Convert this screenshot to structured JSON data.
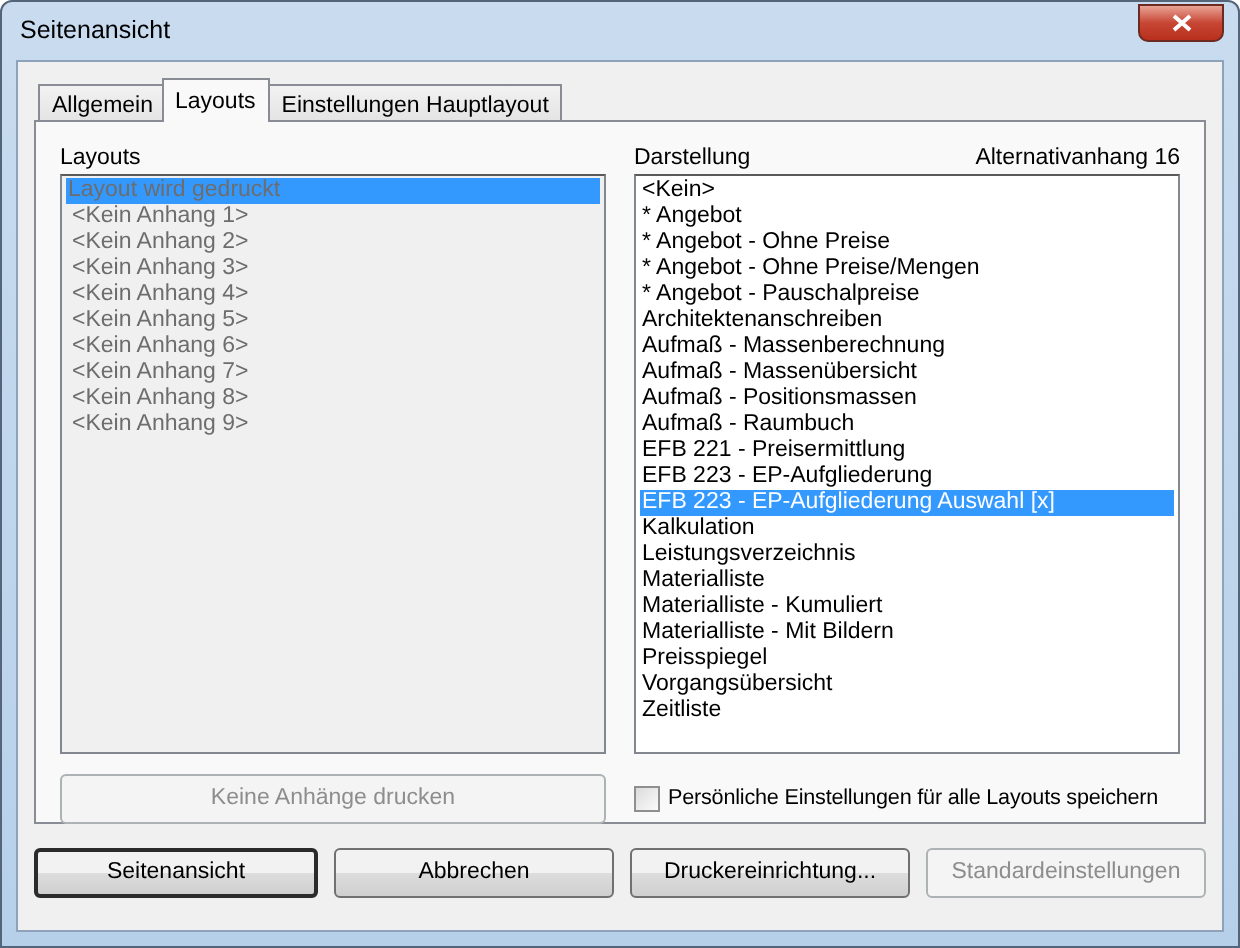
{
  "window": {
    "title": "Seitenansicht"
  },
  "tabs": [
    {
      "label": "Allgemein",
      "selected": false
    },
    {
      "label": "Layouts",
      "selected": true
    },
    {
      "label": "Einstellungen Hauptlayout",
      "selected": false
    }
  ],
  "layouts": {
    "label": "Layouts",
    "disabled": true,
    "items": [
      {
        "label": "Layout wird gedruckt",
        "selected": true
      },
      {
        "label": "<Kein Anhang 1>",
        "selected": false
      },
      {
        "label": "<Kein Anhang 2>",
        "selected": false
      },
      {
        "label": "<Kein Anhang 3>",
        "selected": false
      },
      {
        "label": "<Kein Anhang 4>",
        "selected": false
      },
      {
        "label": "<Kein Anhang 5>",
        "selected": false
      },
      {
        "label": "<Kein Anhang 6>",
        "selected": false
      },
      {
        "label": "<Kein Anhang 7>",
        "selected": false
      },
      {
        "label": "<Kein Anhang 8>",
        "selected": false
      },
      {
        "label": "<Kein Anhang 9>",
        "selected": false
      }
    ]
  },
  "darstellung": {
    "label": "Darstellung",
    "info": "Alternativanhang 16",
    "items": [
      {
        "label": "<Kein>",
        "selected": false
      },
      {
        "label": "* Angebot",
        "selected": false
      },
      {
        "label": "* Angebot - Ohne Preise",
        "selected": false
      },
      {
        "label": "* Angebot - Ohne Preise/Mengen",
        "selected": false
      },
      {
        "label": "* Angebot - Pauschalpreise",
        "selected": false
      },
      {
        "label": "Architektenanschreiben",
        "selected": false
      },
      {
        "label": "Aufmaß - Massenberechnung",
        "selected": false
      },
      {
        "label": "Aufmaß - Massenübersicht",
        "selected": false
      },
      {
        "label": "Aufmaß - Positionsmassen",
        "selected": false
      },
      {
        "label": "Aufmaß - Raumbuch",
        "selected": false
      },
      {
        "label": "EFB 221 - Preisermittlung",
        "selected": false
      },
      {
        "label": "EFB 223 - EP-Aufgliederung",
        "selected": false
      },
      {
        "label": "EFB 223 - EP-Aufgliederung Auswahl [x]",
        "selected": true
      },
      {
        "label": "Kalkulation",
        "selected": false
      },
      {
        "label": "Leistungsverzeichnis",
        "selected": false
      },
      {
        "label": "Materialliste",
        "selected": false
      },
      {
        "label": "Materialliste - Kumuliert",
        "selected": false
      },
      {
        "label": "Materialliste - Mit Bildern",
        "selected": false
      },
      {
        "label": "Preisspiegel",
        "selected": false
      },
      {
        "label": "Vorgangsübersicht",
        "selected": false
      },
      {
        "label": "Zeitliste",
        "selected": false
      }
    ]
  },
  "no_attachments_button": {
    "label": "Keine Anhänge drucken",
    "disabled": true
  },
  "save_checkbox": {
    "label": "Persönliche Einstellungen für alle Layouts speichern",
    "checked": false
  },
  "buttons": [
    {
      "label": "Seitenansicht",
      "default": true,
      "disabled": false
    },
    {
      "label": "Abbrechen",
      "default": false,
      "disabled": false
    },
    {
      "label": "Druckereinrichtung...",
      "default": false,
      "disabled": false
    },
    {
      "label": "Standardeinstellungen",
      "default": false,
      "disabled": true
    }
  ]
}
